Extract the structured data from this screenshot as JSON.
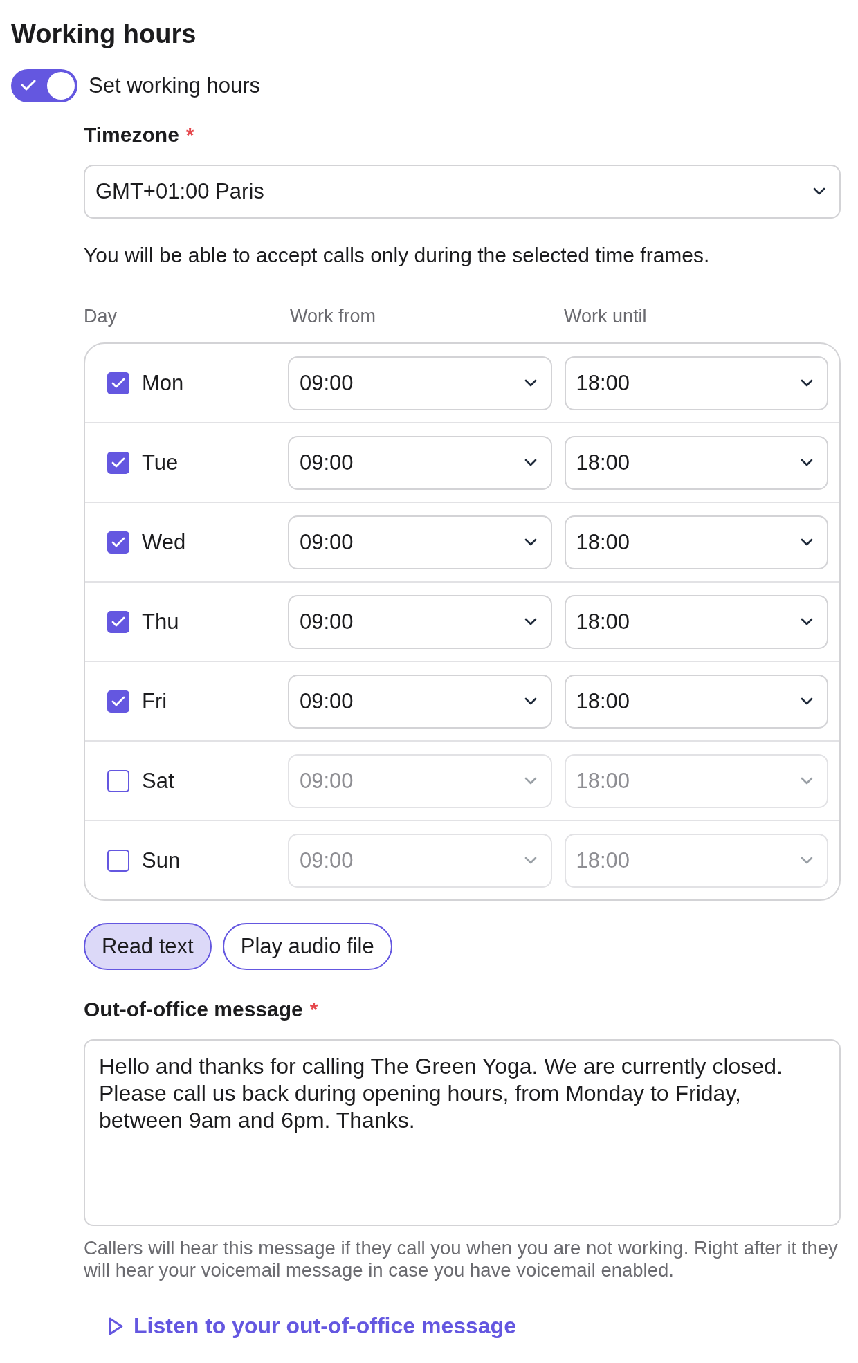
{
  "title": "Working hours",
  "working_hours_toggle": {
    "label": "Set working hours",
    "on": true
  },
  "timezone": {
    "label": "Timezone",
    "required_mark": "*",
    "value": "GMT+01:00 Paris"
  },
  "description": "You will be able to accept calls only during the selected time frames.",
  "table": {
    "columns": [
      "Day",
      "Work from",
      "Work until"
    ],
    "rows": [
      {
        "day": "Mon",
        "checked": true,
        "from": "09:00",
        "until": "18:00"
      },
      {
        "day": "Tue",
        "checked": true,
        "from": "09:00",
        "until": "18:00"
      },
      {
        "day": "Wed",
        "checked": true,
        "from": "09:00",
        "until": "18:00"
      },
      {
        "day": "Thu",
        "checked": true,
        "from": "09:00",
        "until": "18:00"
      },
      {
        "day": "Fri",
        "checked": true,
        "from": "09:00",
        "until": "18:00"
      },
      {
        "day": "Sat",
        "checked": false,
        "from": "09:00",
        "until": "18:00"
      },
      {
        "day": "Sun",
        "checked": false,
        "from": "09:00",
        "until": "18:00"
      }
    ]
  },
  "message_modes": [
    {
      "label": "Read text",
      "selected": true
    },
    {
      "label": "Play audio file",
      "selected": false
    }
  ],
  "out_of_office": {
    "label": "Out-of-office message",
    "required_mark": "*",
    "value": "Hello and thanks for calling The Green Yoga. We are currently closed. Please call us back during opening hours, from Monday to Friday, between 9am and 6pm. Thanks.",
    "help": "Callers will hear this message if they call you when you are not working. Right after it they will hear your voicemail message in case you have voicemail enabled."
  },
  "listen_link": "Listen to your out-of-office message"
}
